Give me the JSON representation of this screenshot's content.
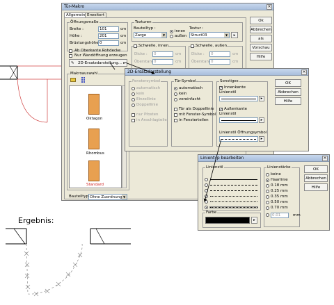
{
  "main_dialog": {
    "title": "Tür-Makro",
    "tabs": [
      "Allgemein",
      "Erweitert"
    ],
    "oeffnungsmasse": {
      "group_label": "Öffnungsmaße",
      "breite_label": "Breite :",
      "breite_value": "101",
      "breite_unit": "cm",
      "hoehe_label": "Höhe :",
      "hoehe_value": "201",
      "hoehe_unit": "cm",
      "bruestung_label": "Brüstungshöhe :",
      "bruestung_value": "0",
      "bruestung_unit": "cm"
    },
    "ab_oberkante_label": "Ab Oberkante Rohdecke",
    "nur_wandoeffnung_label": "Nur Wandöffnung erzeugen",
    "ersatzdarstellung_button": "2D-Ersatzdarstellung...",
    "texturen": {
      "group_label": "Texturen",
      "bauteiltyp_label": "Bauteiltyp :",
      "bauteiltyp_value": "Zarge",
      "innen_label": "innen",
      "aussen_label": "außen",
      "textur_label": "Textur :",
      "textur_value": "Struct03"
    },
    "schwelle_innen": {
      "label": "Schwelle, innen",
      "dicke_label": "Dicke :",
      "dicke_value": "0",
      "ueberstand_label": "Überstand :",
      "ueberstand_value": "0",
      "unit": "cm"
    },
    "schwelle_aussen": {
      "label": "Schwelle, außen",
      "dicke_label": "Dicke :",
      "dicke_value": "0",
      "ueberstand_label": "Überstand :",
      "ueberstand_value": "0",
      "unit": "cm"
    },
    "makroauswahl_label": "Makroauswahl",
    "macros": [
      "Oktagon",
      "Rhombus",
      "Standard"
    ],
    "bauteiltyp_label": "Bauteiltyp :",
    "bauteiltyp_value": "Ohne Zuordnung",
    "buttons": [
      "Ok",
      "Abbrechen",
      "als Standard",
      "Vorschau",
      "Hilfe"
    ]
  },
  "ersatz_dialog": {
    "title": "2D-Ersatzdarstellung",
    "tuersymbol": {
      "label": "Tür-Symbol",
      "options": [
        "automatisch",
        "kein",
        "vereinfacht"
      ],
      "checks": [
        "Tür als Doppellinie",
        "mit Fenster-Symbol",
        "in Fensterteilen"
      ]
    },
    "fensymbol": {
      "label": "Fenstersymbol",
      "options": [
        "automatisch",
        "kein",
        "Einzellinie",
        "Doppellinie"
      ],
      "checks": [
        "nur Pfosten",
        "in Anschlagteile"
      ]
    },
    "sonstiges": {
      "label": "Sonstiges",
      "innenkante": "Innenkante",
      "linienstil1": "Linienstil",
      "aussenkante": "Außenkante",
      "linienstil2": "Linienstil",
      "linienstil_oeffnung": "Linienstil Öffnungsymbol"
    },
    "buttons": [
      "OK",
      "Abbrechen",
      "Hilfe"
    ]
  },
  "linien_dialog": {
    "title": "Linientyp bearbeiten",
    "linienstil_label": "Linienstil",
    "farbe_label": "Farbe",
    "linienstaerke_label": "Linienstärke",
    "staerken": [
      "keine",
      "Haarlinie",
      "0.18 mm",
      "0.25 mm",
      "0.35 mm",
      "0.50 mm",
      "0.70 mm"
    ],
    "custom_value": "0.01",
    "custom_unit": "mm",
    "buttons": [
      "OK",
      "Abbrechen",
      "Hilfe"
    ]
  },
  "ergebnis_label": "Ergebnis:"
}
